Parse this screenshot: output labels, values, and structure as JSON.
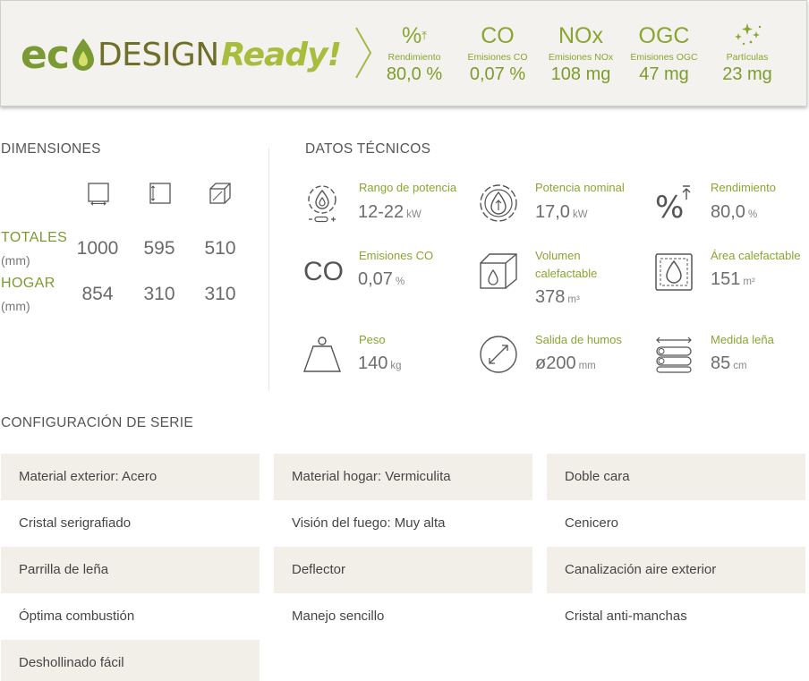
{
  "banner": {
    "logo": {
      "eco": "ec",
      "design": "DESIGN",
      "ready": "Ready!"
    },
    "colors": {
      "accent": "#8aa531",
      "logo_dark": "#6f6f2a",
      "logo_light": "#a7bd3b"
    },
    "stats": [
      {
        "top": "%",
        "label": "Rendimiento",
        "value": "80,0 %"
      },
      {
        "top": "CO",
        "label": "Emisiones CO",
        "value": "0,07 %"
      },
      {
        "top": "NOx",
        "label": "Emisiones NOx",
        "value": "108 mg"
      },
      {
        "top": "OGC",
        "label": "Emisiones OGC",
        "value": "47 mg"
      },
      {
        "top": "",
        "label": "Partículas",
        "value": "23 mg"
      }
    ]
  },
  "dimensions": {
    "title": "DIMENSIONES",
    "icons": [
      "width-icon",
      "height-icon",
      "depth-icon"
    ],
    "rows": [
      {
        "label": "TOTALES",
        "unit": "(mm)",
        "values": [
          "1000",
          "595",
          "510"
        ]
      },
      {
        "label": "HOGAR",
        "unit": "(mm)",
        "values": [
          "854",
          "310",
          "310"
        ]
      }
    ]
  },
  "tech": {
    "title": "DATOS TÉCNICOS",
    "items": [
      {
        "icon": "power-range-icon",
        "label": "Rango de potencia",
        "value": "12-22",
        "unit": "kW"
      },
      {
        "icon": "nominal-power-icon",
        "label": "Potencia nominal",
        "value": "17,0",
        "unit": "kW"
      },
      {
        "icon": "efficiency-icon",
        "label": "Rendimiento",
        "value": "80,0",
        "unit": "%"
      },
      {
        "icon": "co-emissions-icon",
        "icon_text": "CO",
        "label": "Emisiones CO",
        "value": "0,07",
        "unit": "%"
      },
      {
        "icon": "heated-volume-icon",
        "label": "Volumen calefactable",
        "value": "378",
        "unit": "m³"
      },
      {
        "icon": "heated-area-icon",
        "label": "Área calefactable",
        "value": "151",
        "unit": "m²"
      },
      {
        "icon": "weight-icon",
        "label": "Peso",
        "value": "140",
        "unit": "kg"
      },
      {
        "icon": "flue-outlet-icon",
        "label": "Salida de humos",
        "value": "ø200",
        "unit": "mm"
      },
      {
        "icon": "log-length-icon",
        "label": "Medida leña",
        "value": "85",
        "unit": "cm"
      }
    ]
  },
  "config": {
    "title": "CONFIGURACIÓN DE SERIE",
    "items": [
      "Material exterior: Acero",
      "Material hogar: Vermiculita",
      "Doble cara",
      "Cristal serigrafiado",
      "Visión del fuego: Muy alta",
      "Cenicero",
      "Parrilla de leña",
      "Deflector",
      "Canalización aire exterior",
      "Óptima combustión",
      "Manejo sencillo",
      "Cristal anti-manchas",
      "Deshollinado fácil"
    ]
  }
}
